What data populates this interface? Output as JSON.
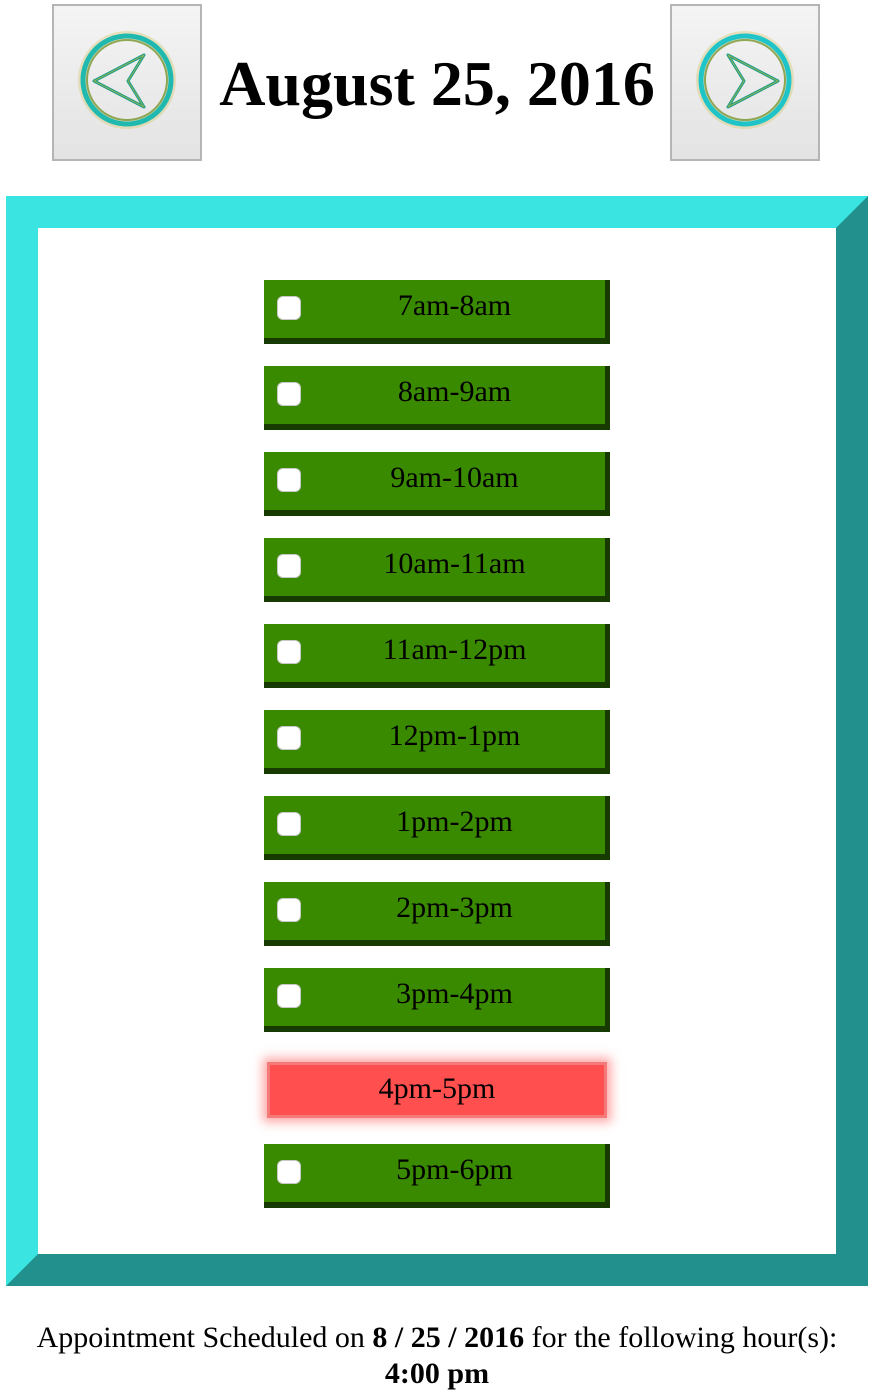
{
  "header": {
    "date_title": "August 25, 2016",
    "prev_icon": "circle-left-arrow-icon",
    "next_icon": "circle-right-arrow-icon"
  },
  "colors": {
    "frame_light": "#3ae4e0",
    "frame_dark": "#22918e",
    "slot_green": "#3a8a00",
    "slot_shadow": "#163a00",
    "slot_selected": "#ff4f4f"
  },
  "slots": [
    {
      "label": "7am-8am",
      "selected": false
    },
    {
      "label": "8am-9am",
      "selected": false
    },
    {
      "label": "9am-10am",
      "selected": false
    },
    {
      "label": "10am-11am",
      "selected": false
    },
    {
      "label": "11am-12pm",
      "selected": false
    },
    {
      "label": "12pm-1pm",
      "selected": false
    },
    {
      "label": "1pm-2pm",
      "selected": false
    },
    {
      "label": "2pm-3pm",
      "selected": false
    },
    {
      "label": "3pm-4pm",
      "selected": false
    },
    {
      "label": "4pm-5pm",
      "selected": true
    },
    {
      "label": "5pm-6pm",
      "selected": false
    }
  ],
  "summary": {
    "prefix": "Appointment Scheduled on ",
    "date": "8 / 25 / 2016",
    "middle": " for the following hour(s):",
    "hours": "4:00 pm"
  }
}
